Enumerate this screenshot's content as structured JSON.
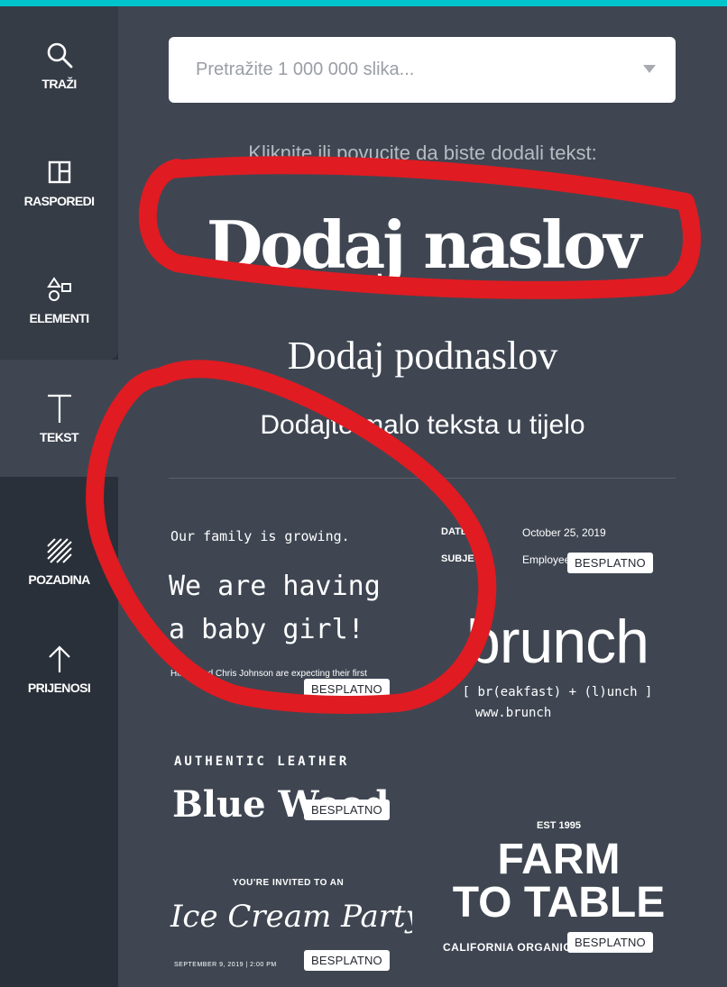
{
  "sidebar": {
    "items": [
      {
        "id": "search",
        "label": "TRAŽI",
        "icon": "search-icon"
      },
      {
        "id": "layouts",
        "label": "RASPOREDI",
        "icon": "layout-icon"
      },
      {
        "id": "elements",
        "label": "ELEMENTI",
        "icon": "shapes-icon"
      },
      {
        "id": "text",
        "label": "TEKST",
        "icon": "text-icon",
        "active": true
      },
      {
        "id": "background",
        "label": "POZADINA",
        "icon": "pattern-icon"
      },
      {
        "id": "uploads",
        "label": "PRIJENOSI",
        "icon": "upload-arrow-icon"
      }
    ]
  },
  "search": {
    "placeholder": "Pretražite 1 000 000 slika..."
  },
  "panel": {
    "hint": "Kliknite ili povucite da biste dodali tekst:",
    "heading": "Dodaj naslov",
    "subheading": "Dodaj podnaslov",
    "body": "Dodajte malo teksta u tijelo"
  },
  "badge_label": "BESPLATNO",
  "templates": {
    "baby": {
      "line1": "Our family is growing.",
      "line2": "We are having a baby girl!",
      "line3": "Hillary and Chris Johnson are expecting their first"
    },
    "brunch": {
      "date_label": "DATE:",
      "subject_label": "SUBJECT:",
      "date_value": "October 25, 2019",
      "subject_value": "Employee",
      "title": "brunch",
      "subtitle": "[ br(eakfast) + (l)unch ]",
      "url": "www.brunch"
    },
    "leather": {
      "line1": "AUTHENTIC LEATHER",
      "line2": "Blue Wood"
    },
    "icecream": {
      "line1": "YOU'RE INVITED TO AN",
      "line2": "Ice Cream Party",
      "line3": "SEPTEMBER 9, 2019 | 2:00 PM"
    },
    "farm": {
      "line1": "EST 1995",
      "line2": "FARM",
      "line3": "TO TABLE",
      "line4": "CALIFORNIA ORGANIC"
    }
  },
  "colors": {
    "accent": "#00c4cc",
    "panel": "#3f4652",
    "sidebar": "#293039",
    "annotation": "#e01b22"
  }
}
